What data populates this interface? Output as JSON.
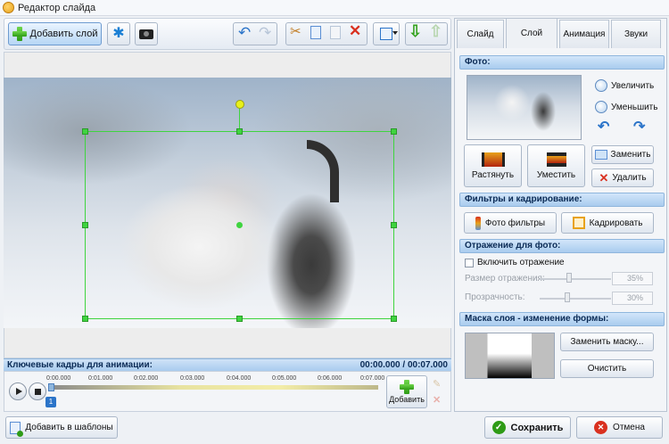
{
  "window": {
    "title": "Редактор слайда"
  },
  "toolbar": {
    "add_layer": "Добавить слой",
    "icons": [
      "effects-icon",
      "camera-icon",
      "undo-icon",
      "redo-icon",
      "cut-icon",
      "copy-icon",
      "paste-icon",
      "delete-icon",
      "fit-icon",
      "dropdown-icon",
      "move-down-icon",
      "move-up-icon"
    ]
  },
  "keyframes": {
    "label": "Ключевые кадры для анимации:",
    "time": "00:00.000 / 00:07.000",
    "ticks": [
      "0:00.000",
      "0:01.000",
      "0:02.000",
      "0:03.000",
      "0:04.000",
      "0:05.000",
      "0:06.000",
      "0:07.000"
    ],
    "marker": "1",
    "add_label": "Добавить"
  },
  "tabs": [
    "Слайд",
    "Слой",
    "Анимация",
    "Звуки"
  ],
  "active_tab": "Слой",
  "photo_section": {
    "title": "Фото:",
    "zoom_in": "Увеличить",
    "zoom_out": "Уменьшить",
    "stretch": "Растянуть",
    "fit": "Уместить",
    "replace": "Заменить",
    "delete": "Удалить"
  },
  "filters_section": {
    "title": "Фильтры и кадрирование:",
    "photo_filters": "Фото фильтры",
    "crop": "Кадрировать"
  },
  "reflection_section": {
    "title": "Отражение для фото:",
    "enable": "Включить отражение",
    "size_label": "Размер отражения:",
    "size_value": "35%",
    "opacity_label": "Прозрачность:",
    "opacity_value": "30%"
  },
  "mask_section": {
    "title": "Маска слоя - изменение формы:",
    "replace_mask": "Заменить маску...",
    "clear": "Очистить"
  },
  "bottom": {
    "add_template": "Добавить в шаблоны",
    "save": "Сохранить",
    "cancel": "Отмена"
  },
  "colors": {
    "accent": "#a9cbee",
    "selection": "#3fd43f",
    "save": "#2e9b16",
    "cancel": "#d9301f"
  }
}
